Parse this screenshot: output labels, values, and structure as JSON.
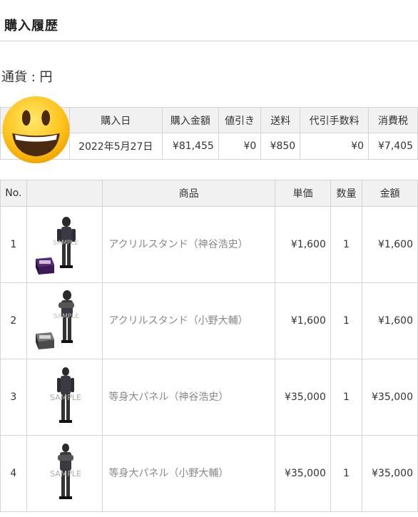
{
  "page": {
    "title": "購入履歴",
    "currency_label": "通貨 : 円"
  },
  "summary": {
    "headers": [
      "購入日",
      "購入金額",
      "値引き",
      "送料",
      "代引手数料",
      "消費税"
    ],
    "date": "2022年5月27日",
    "amount": "¥81,455",
    "discount": "¥0",
    "shipping": "¥850",
    "cod_fee": "¥0",
    "tax": "¥7,405"
  },
  "items_table": {
    "headers": [
      "No.",
      "",
      "商品",
      "単価",
      "数量",
      "金額"
    ],
    "rows": [
      {
        "no": "1",
        "name": "アクリルスタンド（神谷浩史）",
        "unit_price": "¥1,600",
        "qty": "1",
        "amount": "¥1,600",
        "thumb_label": "SAMPLE",
        "base_color": "#5a2a7a"
      },
      {
        "no": "2",
        "name": "アクリルスタンド（小野大輔）",
        "unit_price": "¥1,600",
        "qty": "1",
        "amount": "¥1,600",
        "thumb_label": "SAMPLE",
        "base_color": "#555555"
      },
      {
        "no": "3",
        "name": "等身大パネル（神谷浩史）",
        "unit_price": "¥35,000",
        "qty": "1",
        "amount": "¥35,000",
        "thumb_label": "SAMPLE"
      },
      {
        "no": "4",
        "name": "等身大パネル（小野大輔）",
        "unit_price": "¥35,000",
        "qty": "1",
        "amount": "¥35,000",
        "thumb_label": "SAMPLE"
      }
    ]
  },
  "overlay": {
    "icon": "grinning-face-emoji-icon",
    "face_color": "#ffcc22"
  }
}
